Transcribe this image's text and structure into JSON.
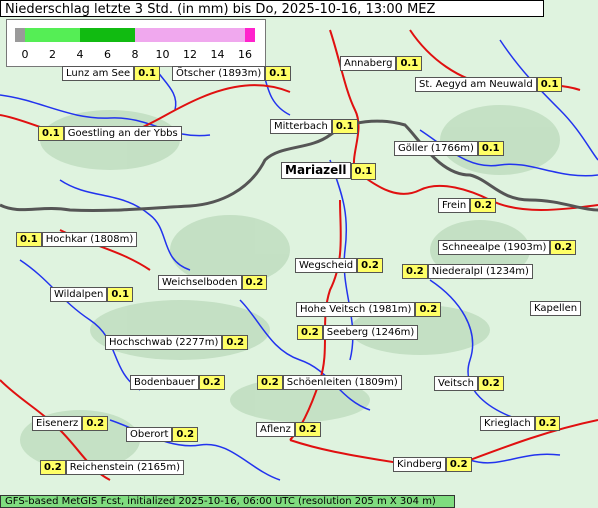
{
  "title": "Niederschlag letzte 3 Std. (in mm) bis Do, 2025-10-16, 13:00 MEZ",
  "footer": "GFS-based MetGIS Fcst, initialized 2025-10-16, 06:00 UTC  (resolution 205 m X 304 m)",
  "legend": {
    "ticks": [
      "0",
      "2",
      "4",
      "6",
      "8",
      "10",
      "12",
      "14",
      "16"
    ],
    "colors": {
      "below_zero": "#9a9a9a",
      "low": "#55ee55",
      "mid": "#11bb11",
      "high": "#f0a8ee",
      "max": "#ff22cc"
    }
  },
  "colors": {
    "terrain": "#dff3df",
    "rivers": "#2233ee",
    "roads": "#e01010",
    "border": "#555555",
    "value_box": "#ffff66"
  },
  "places": [
    {
      "name": "Lunz am See",
      "value": "0.1",
      "order": "name-first"
    },
    {
      "name": "Ötscher (1893m)",
      "value": "0.1",
      "order": "name-first"
    },
    {
      "name": "Annaberg",
      "value": "0.1",
      "order": "name-first"
    },
    {
      "name": "St. Aegyd am Neuwald",
      "value": "0.1",
      "order": "name-first"
    },
    {
      "name": "Goestling an der Ybbs",
      "value": "0.1",
      "order": "value-first"
    },
    {
      "name": "Mitterbach",
      "value": "0.1",
      "order": "name-first"
    },
    {
      "name": "Göller (1766m)",
      "value": "0.1",
      "order": "name-first"
    },
    {
      "name": "Mariazell",
      "value": "0.1",
      "order": "name-first",
      "major": true
    },
    {
      "name": "Frein",
      "value": "0.2",
      "order": "name-first"
    },
    {
      "name": "Hochkar (1808m)",
      "value": "0.1",
      "order": "value-first"
    },
    {
      "name": "Schneealpe (1903m)",
      "value": "0.2",
      "order": "name-first"
    },
    {
      "name": "Wegscheid",
      "value": "0.2",
      "order": "name-first"
    },
    {
      "name": "Niederalpl (1234m)",
      "value": "0.2",
      "order": "value-first"
    },
    {
      "name": "Weichselboden",
      "value": "0.2",
      "order": "name-first"
    },
    {
      "name": "Wildalpen",
      "value": "0.1",
      "order": "name-first"
    },
    {
      "name": "Hohe Veitsch (1981m)",
      "value": "0.2",
      "order": "name-first"
    },
    {
      "name": "Kapellen",
      "value": "",
      "order": "name-first"
    },
    {
      "name": "Seeberg (1246m)",
      "value": "0.2",
      "order": "value-first"
    },
    {
      "name": "Hochschwab (2277m)",
      "value": "0.2",
      "order": "name-first"
    },
    {
      "name": "Bodenbauer",
      "value": "0.2",
      "order": "name-first"
    },
    {
      "name": "Schöenleiten (1809m)",
      "value": "0.2",
      "order": "value-first"
    },
    {
      "name": "Veitsch",
      "value": "0.2",
      "order": "name-first"
    },
    {
      "name": "Eisenerz",
      "value": "0.2",
      "order": "name-first"
    },
    {
      "name": "Oberort",
      "value": "0.2",
      "order": "name-first"
    },
    {
      "name": "Aflenz",
      "value": "0.2",
      "order": "name-first"
    },
    {
      "name": "Krieglach",
      "value": "0.2",
      "order": "name-first"
    },
    {
      "name": "Reichenstein (2165m)",
      "value": "0.2",
      "order": "value-first"
    },
    {
      "name": "Kindberg",
      "value": "0.2",
      "order": "name-first"
    }
  ]
}
